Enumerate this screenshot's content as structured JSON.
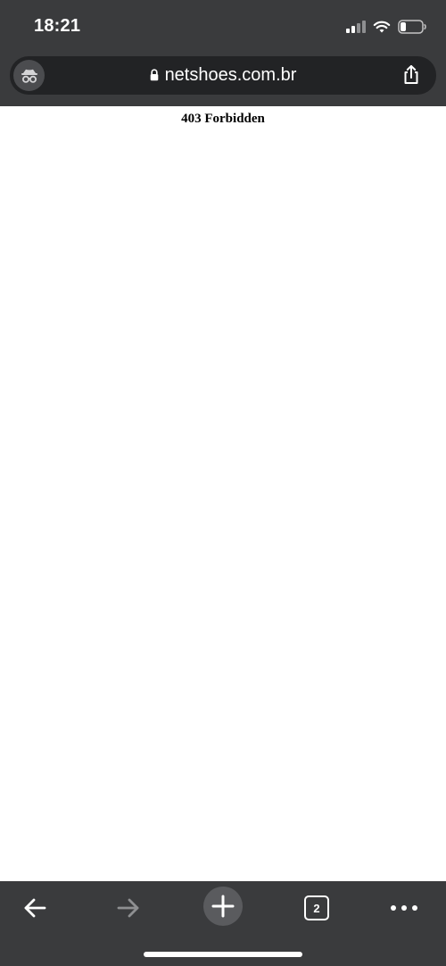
{
  "status_bar": {
    "time": "18:21"
  },
  "browser": {
    "url": "netshoes.com.br",
    "tab_count": "2",
    "colors": {
      "chrome_background": "#3a3b3d",
      "address_bar_background": "#222325",
      "icon_inactive": "#8e8f91",
      "button_fill": "#5a5b5e"
    },
    "icons": {
      "incognito": "incognito-icon",
      "lock": "lock-icon",
      "share": "share-icon",
      "back": "back-arrow-icon",
      "forward": "forward-arrow-icon",
      "new_tab": "plus-icon",
      "tabs": "tabs-icon",
      "menu": "more-icon"
    }
  },
  "page": {
    "heading": "403 Forbidden"
  }
}
